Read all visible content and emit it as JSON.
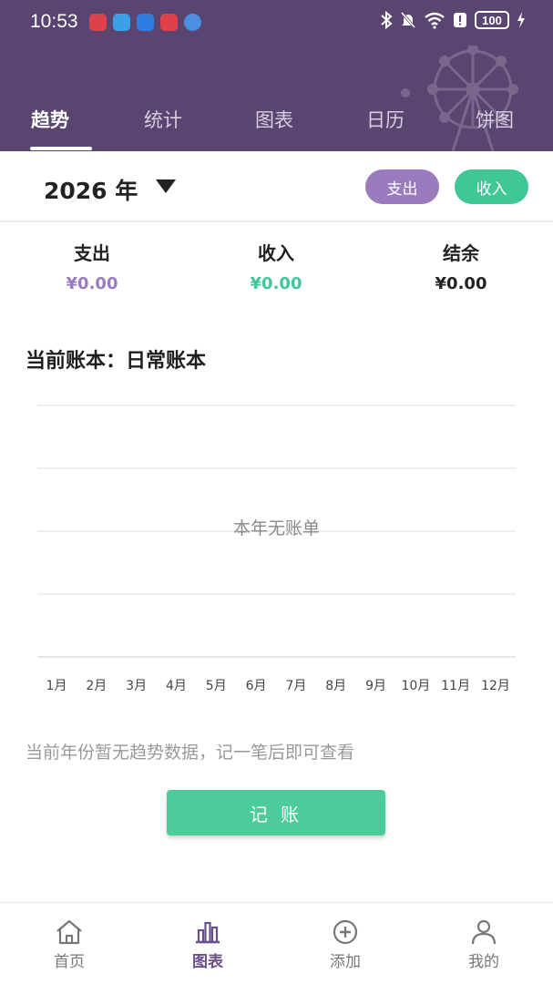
{
  "status_bar": {
    "time": "10:53",
    "battery": "100"
  },
  "tabs": [
    {
      "label": "趋势",
      "active": true
    },
    {
      "label": "统计",
      "active": false
    },
    {
      "label": "图表",
      "active": false
    },
    {
      "label": "日历",
      "active": false
    },
    {
      "label": "饼图",
      "active": false
    }
  ],
  "year_selector": {
    "label": "2026 年"
  },
  "type_toggle": {
    "expense_label": "支出",
    "income_label": "收入"
  },
  "summary": {
    "expense": {
      "label": "支出",
      "value": "¥0.00"
    },
    "income": {
      "label": "收入",
      "value": "¥0.00"
    },
    "balance": {
      "label": "结余",
      "value": "¥0.00"
    }
  },
  "ledger": {
    "label": "当前账本：日常账本"
  },
  "chart_data": {
    "type": "line",
    "categories": [
      "1月",
      "2月",
      "3月",
      "4月",
      "5月",
      "6月",
      "7月",
      "8月",
      "9月",
      "10月",
      "11月",
      "12月"
    ],
    "series": [],
    "empty_text": "本年无账单",
    "grid": true
  },
  "hint": "当前年份暂无趋势数据，记一笔后即可查看",
  "record_button": "记 账",
  "bottom_nav": [
    {
      "label": "首页",
      "icon": "home-icon",
      "active": false
    },
    {
      "label": "图表",
      "icon": "bar-chart-icon",
      "active": true
    },
    {
      "label": "添加",
      "icon": "add-circle-icon",
      "active": false
    },
    {
      "label": "我的",
      "icon": "person-icon",
      "active": false
    }
  ],
  "colors": {
    "header_bg": "#5a4570",
    "expense": "#9a7cbe",
    "income": "#3fc796",
    "accent": "#4ccb9b",
    "nav_active": "#6a4f8a"
  }
}
